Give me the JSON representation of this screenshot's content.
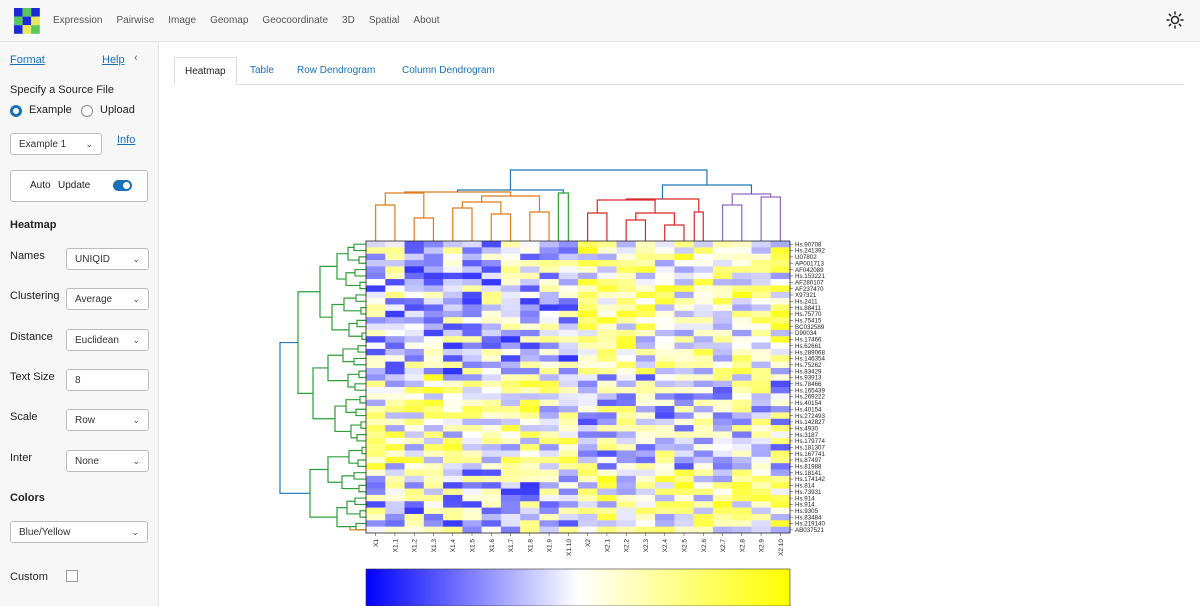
{
  "nav": {
    "items": [
      "Expression",
      "Pairwise",
      "Image",
      "Geomap",
      "Geocoordinate",
      "3D",
      "Spatial",
      "About"
    ],
    "theme_icon": "sun-icon"
  },
  "sidebar": {
    "format_link": "Format",
    "help_link": "Help",
    "source_label": "Specify a Source File",
    "source_options": [
      "Example",
      "Upload"
    ],
    "source_selected": "Example",
    "example_select": "Example 1",
    "info_link": "Info",
    "auto_label": "Auto",
    "update_label": "Update",
    "heatmap_section": "Heatmap",
    "names_label": "Names",
    "names_value": "UNIQID",
    "clustering_label": "Clustering",
    "clustering_value": "Average",
    "distance_label": "Distance",
    "distance_value": "Euclidean",
    "textsize_label": "Text Size",
    "textsize_value": "8",
    "scale_label": "Scale",
    "scale_value": "Row",
    "inter_label": "Inter",
    "inter_value": "None",
    "colors_section": "Colors",
    "colors_value": "Blue/Yellow",
    "custom_label": "Custom"
  },
  "tabs": [
    "Heatmap",
    "Table",
    "Row Dendrogram",
    "Column Dendrogram"
  ],
  "active_tab": "Heatmap",
  "colors": {
    "low": "#0000ff",
    "mid": "#ffffff",
    "high": "#ffff00",
    "accent": "#1a6fb5"
  },
  "chart_data": {
    "type": "heatmap",
    "columns": [
      "X1",
      "X1.1",
      "X1.2",
      "X1.3",
      "X1.4",
      "X1.5",
      "X1.6",
      "X1.7",
      "X1.8",
      "X1.9",
      "X1.10",
      "X2",
      "X2.1",
      "X2.2",
      "X2.3",
      "X2.4",
      "X2.5",
      "X2.6",
      "X2.7",
      "X2.8",
      "X2.9",
      "X2.10"
    ],
    "rows": [
      "Hs.90708",
      "Hs.241392",
      "U07802",
      "AP001713",
      "AF042089",
      "Hs.153221",
      "AF280107",
      "AF237470",
      "X97321",
      "Hs.2411",
      "Hs.88411",
      "Hs.75770",
      "Hs.75415",
      "BC032589",
      "D90034",
      "Hs.17466",
      "Hs.62661",
      "Hs.289068",
      "Hs.146354",
      "Hs.75262",
      "Hs.83429",
      "Hs.93913",
      "Hs.78466",
      "Hs.165439",
      "Hs.269222",
      "Hs.40154",
      "Hs.40154",
      "Hs.272493",
      "Hs.142827",
      "Hs.4930",
      "Hs.3187",
      "Hs.179774",
      "Hs.181307",
      "Hs.167741",
      "Hs.87497",
      "Hs.81988",
      "Hs.18141",
      "Hs.174142",
      "Hs.814",
      "Hs.73931",
      "Hs.914",
      "Hs.914",
      "Hs.9305",
      "Hs.83484",
      "Hs.219140",
      "AB037521"
    ],
    "color_scale": {
      "low": "blue",
      "mid": "white",
      "high": "yellow"
    },
    "column_dendrogram_colors": [
      "#e07b1a",
      "#2e9e3a",
      "#d62728",
      "#9467bd",
      "#1f77b4"
    ],
    "row_dendrogram_colors": [
      "#2e9e3a",
      "#1f77b4",
      "#e07b1a"
    ]
  }
}
